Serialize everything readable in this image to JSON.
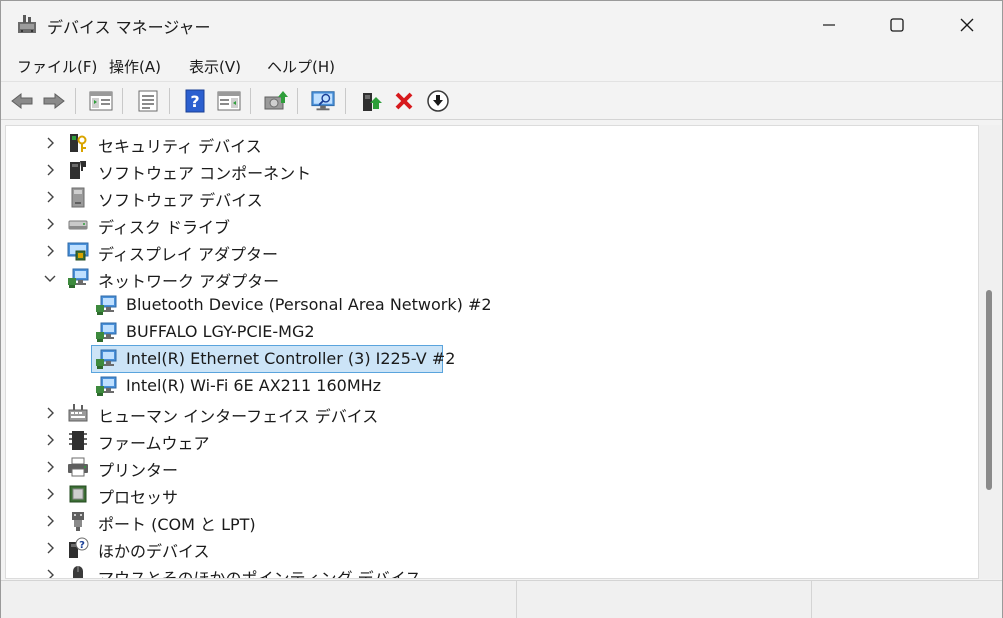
{
  "window": {
    "title": "デバイス マネージャー"
  },
  "menu": [
    {
      "label": "ファイル(F)"
    },
    {
      "label": "操作(A)"
    },
    {
      "label": "表示(V)"
    },
    {
      "label": "ヘルプ(H)"
    }
  ],
  "toolbar": [
    {
      "icon": "back-arrow-icon"
    },
    {
      "icon": "forward-arrow-icon"
    },
    {
      "icon": "show-hide-console-tree-icon"
    },
    {
      "icon": "properties-icon"
    },
    {
      "icon": "help-icon"
    },
    {
      "icon": "action-pane-icon"
    },
    {
      "icon": "update-driver-icon"
    },
    {
      "icon": "scan-hardware-icon"
    },
    {
      "icon": "enable-device-icon"
    },
    {
      "icon": "uninstall-device-icon"
    },
    {
      "icon": "disable-device-icon"
    }
  ],
  "tree": [
    {
      "label": "セキュリティ デバイス",
      "expanded": false,
      "level": 0,
      "icon": "security-key-icon"
    },
    {
      "label": "ソフトウェア コンポーネント",
      "expanded": false,
      "level": 0,
      "icon": "software-component-icon"
    },
    {
      "label": "ソフトウェア デバイス",
      "expanded": false,
      "level": 0,
      "icon": "software-device-icon"
    },
    {
      "label": "ディスク ドライブ",
      "expanded": false,
      "level": 0,
      "icon": "disk-drive-icon"
    },
    {
      "label": "ディスプレイ アダプター",
      "expanded": false,
      "level": 0,
      "icon": "display-adapter-icon"
    },
    {
      "label": "ネットワーク アダプター",
      "expanded": true,
      "level": 0,
      "icon": "network-adapter-icon"
    },
    {
      "label": "Bluetooth Device (Personal Area Network) #2",
      "level": 1,
      "icon": "network-adapter-icon"
    },
    {
      "label": "BUFFALO LGY-PCIE-MG2",
      "level": 1,
      "icon": "network-adapter-icon"
    },
    {
      "label": "Intel(R) Ethernet Controller (3) I225-V #2",
      "level": 1,
      "icon": "network-adapter-icon",
      "selected": true
    },
    {
      "label": "Intel(R) Wi-Fi 6E AX211 160MHz",
      "level": 1,
      "icon": "network-adapter-icon"
    },
    {
      "label": "ヒューマン インターフェイス デバイス",
      "expanded": false,
      "level": 0,
      "icon": "hid-icon"
    },
    {
      "label": "ファームウェア",
      "expanded": false,
      "level": 0,
      "icon": "firmware-icon"
    },
    {
      "label": "プリンター",
      "expanded": false,
      "level": 0,
      "icon": "printer-icon"
    },
    {
      "label": "プロセッサ",
      "expanded": false,
      "level": 0,
      "icon": "processor-icon"
    },
    {
      "label": "ポート (COM と LPT)",
      "expanded": false,
      "level": 0,
      "icon": "port-icon"
    },
    {
      "label": "ほかのデバイス",
      "expanded": false,
      "level": 0,
      "icon": "other-device-icon"
    },
    {
      "label": "マウスとそのほかのポインティング デバイス",
      "expanded": false,
      "level": 0,
      "icon": "mouse-icon"
    }
  ],
  "colors": {
    "selection_bg": "#cce4f7",
    "selection_border": "#5aa4dd",
    "uninstall_red": "#d7191c",
    "enable_green": "#2e9e3a"
  }
}
